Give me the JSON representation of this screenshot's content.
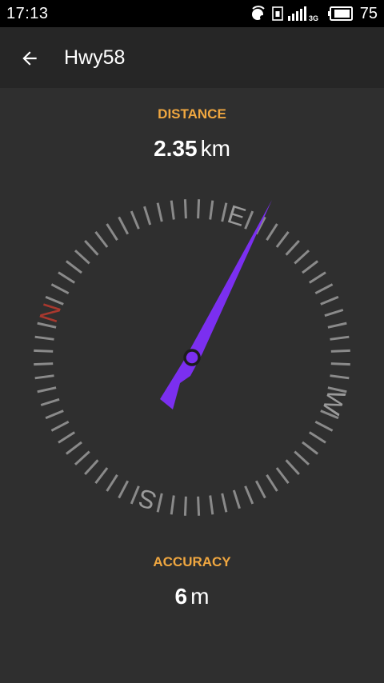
{
  "status_bar": {
    "time": "17:13",
    "network_label": "3G",
    "battery_level": "75",
    "icons": [
      "sync-icon",
      "sim-icon",
      "signal-icon",
      "battery-icon"
    ]
  },
  "app_bar": {
    "back_icon": "back-arrow-icon",
    "title": "Hwy58"
  },
  "distance": {
    "label": "DISTANCE",
    "value": "2.35",
    "unit": "km"
  },
  "compass": {
    "letters": {
      "north": "N",
      "east": "E",
      "south": "S",
      "west": "W"
    },
    "north_color": "#a8382e",
    "needle_color": "#7b2ff0"
  },
  "accuracy": {
    "label": "ACCURACY",
    "value": "6",
    "unit": "m"
  },
  "colors": {
    "accent_label": "#f0a740",
    "background": "#2f2f2f",
    "app_bar": "#262626",
    "status_bar": "#000000"
  }
}
